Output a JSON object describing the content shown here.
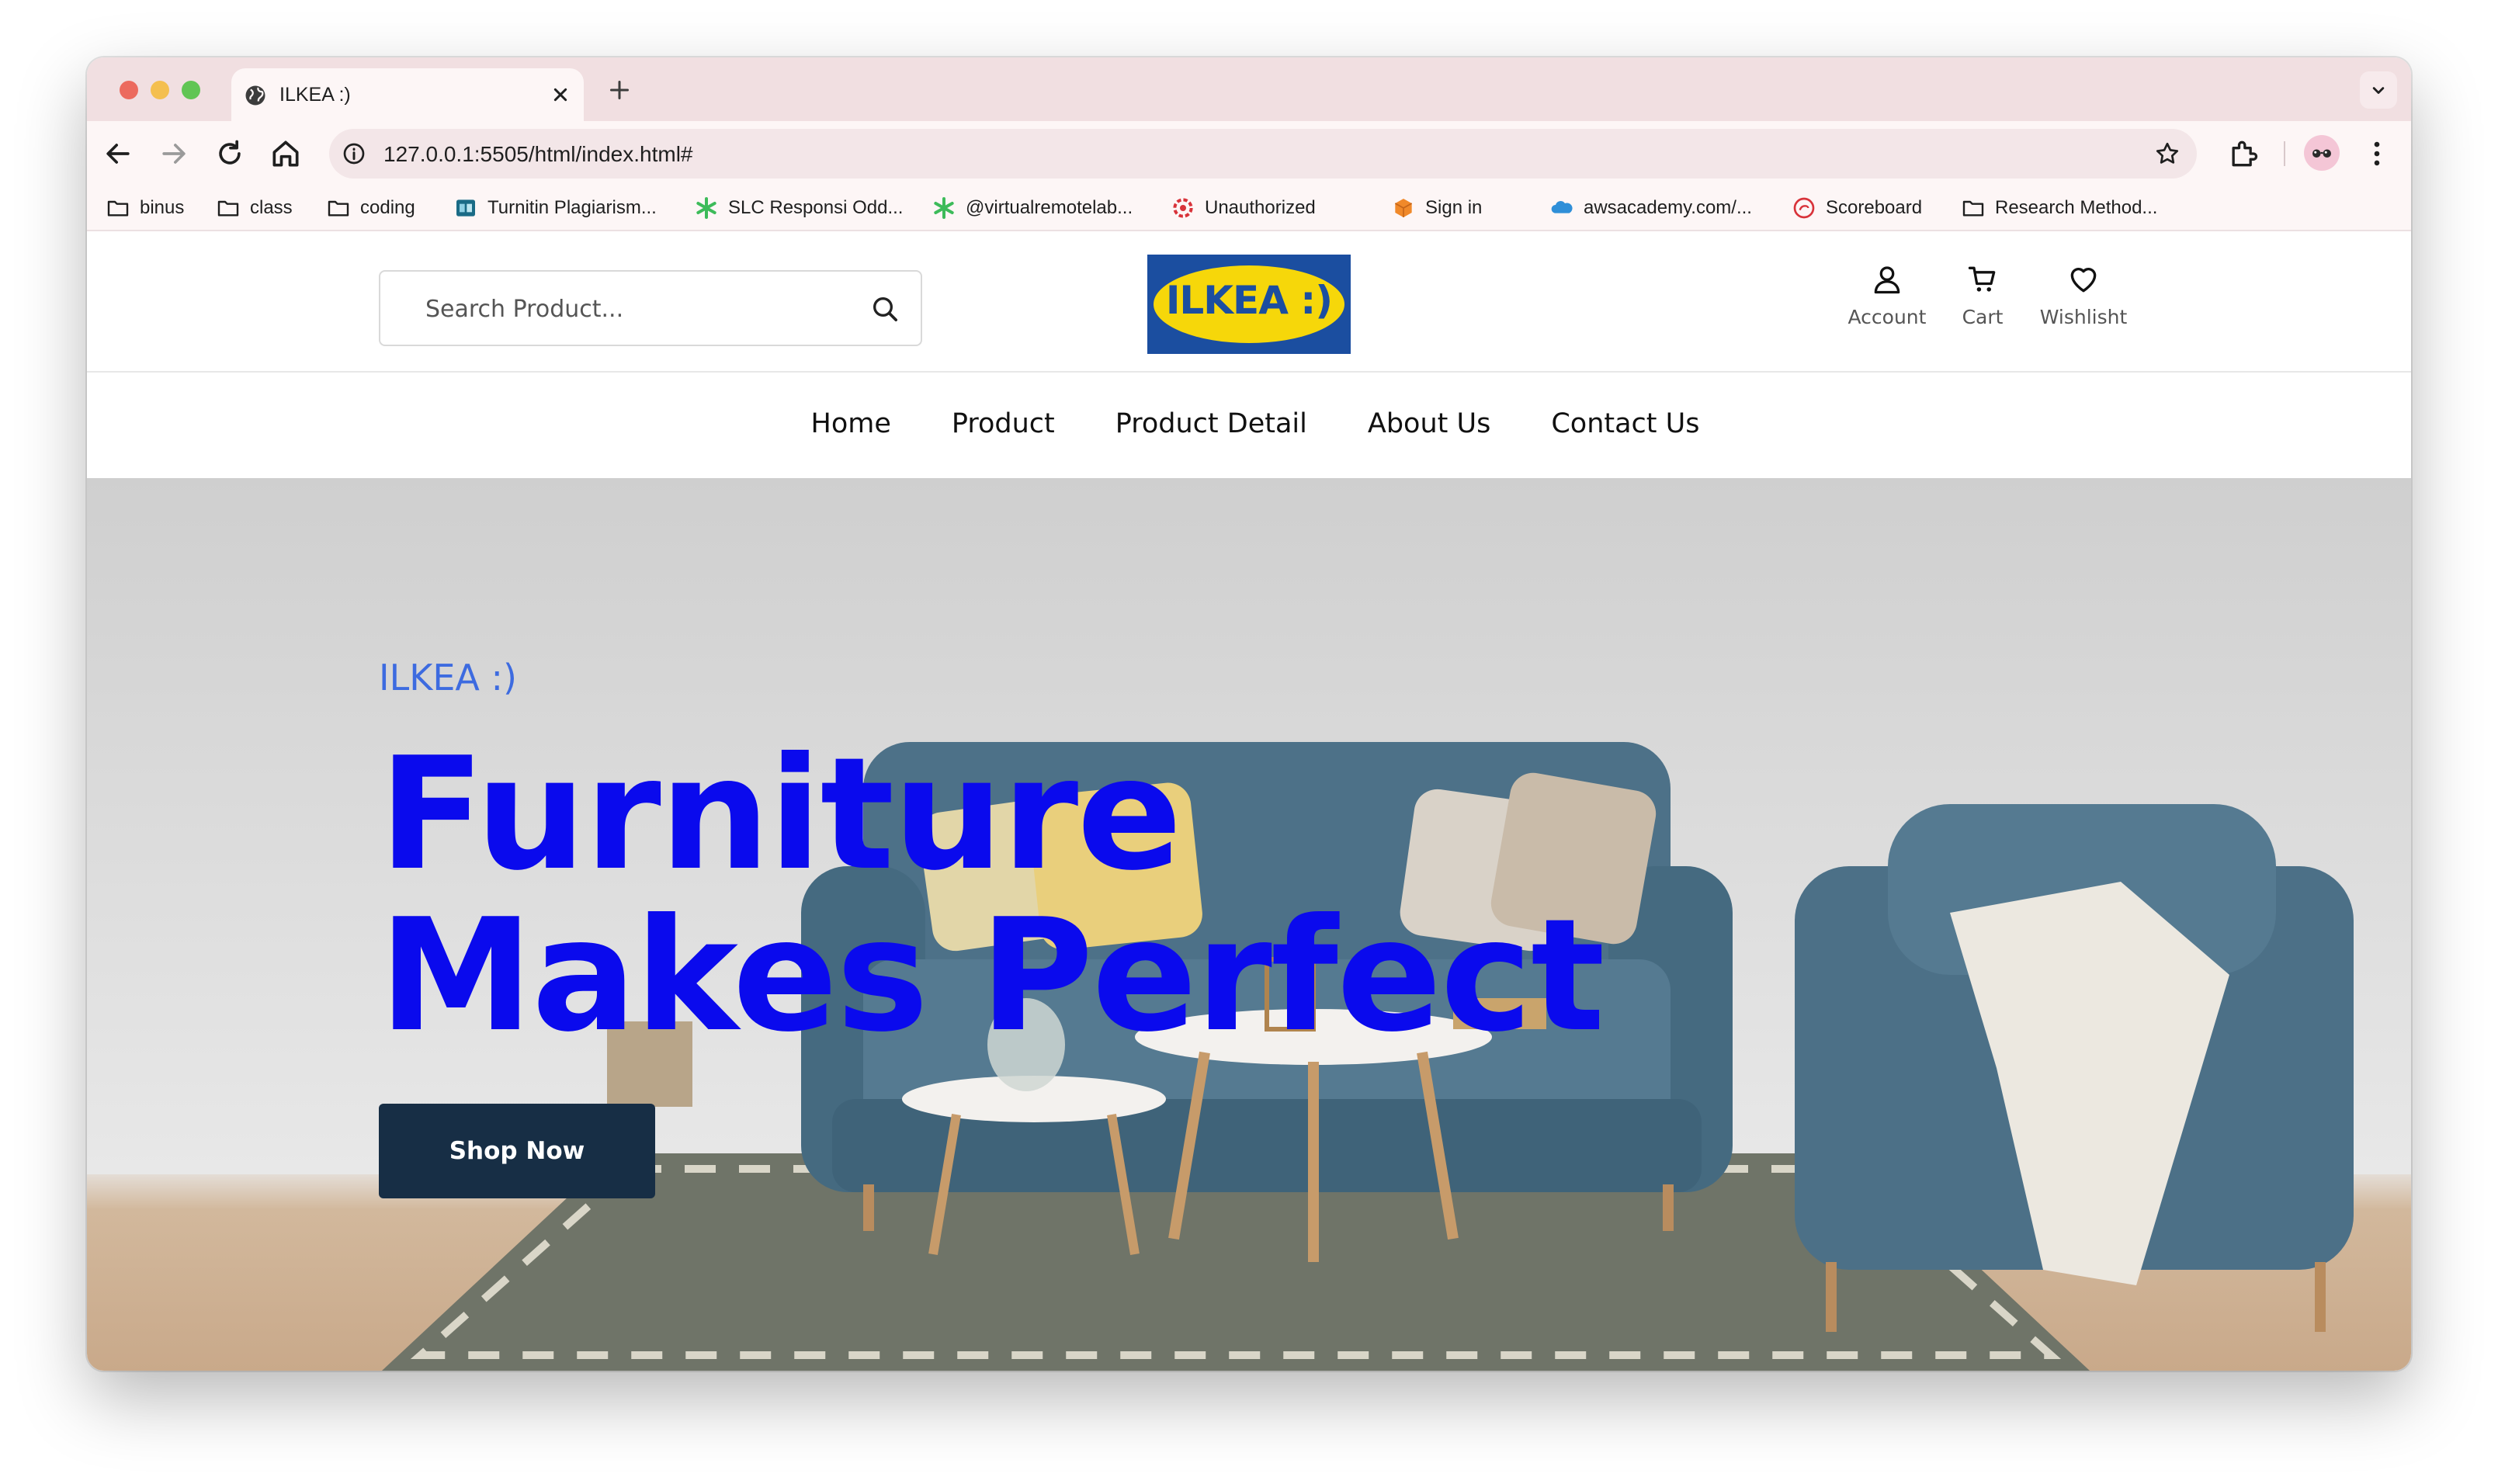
{
  "browser": {
    "tab_title": "ILKEA :)",
    "url": "127.0.0.1:5505/html/index.html#",
    "bookmarks": [
      {
        "label": "binus",
        "icon": "folder-icon"
      },
      {
        "label": "class",
        "icon": "folder-icon"
      },
      {
        "label": "coding",
        "icon": "folder-icon"
      },
      {
        "label": "Turnitin Plagiarism...",
        "icon": "turnitin-icon"
      },
      {
        "label": "SLC Responsi Odd...",
        "icon": "green-asterisk-icon"
      },
      {
        "label": "@virtualremotelab...",
        "icon": "green-asterisk-icon"
      },
      {
        "label": "Unauthorized",
        "icon": "red-gear-icon"
      },
      {
        "label": "Sign in",
        "icon": "orange-cube-icon"
      },
      {
        "label": "awsacademy.com/...",
        "icon": "salesforce-cloud-icon"
      },
      {
        "label": "Scoreboard",
        "icon": "scoreboard-icon"
      },
      {
        "label": "Research Method...",
        "icon": "folder-icon"
      }
    ]
  },
  "site": {
    "search_placeholder": "Search Product...",
    "logo_text": "ILKEA :)",
    "header_links": [
      {
        "label": "Account",
        "icon": "user-icon"
      },
      {
        "label": "Cart",
        "icon": "cart-icon"
      },
      {
        "label": "Wishlisht",
        "icon": "heart-icon"
      }
    ],
    "nav": [
      "Home",
      "Product",
      "Product Detail",
      "About Us",
      "Contact Us"
    ],
    "hero": {
      "kicker": "ILKEA :)",
      "title": "Furniture Makes Perfect",
      "button": "Shop Now"
    }
  },
  "colors": {
    "tab_strip": "#f1dfe1",
    "hero_title": "#0a0aed",
    "hero_kicker": "#3d6be0",
    "button_bg": "#172e45",
    "logo_blue": "#1b4ea0",
    "logo_yellow": "#f6d70a"
  }
}
